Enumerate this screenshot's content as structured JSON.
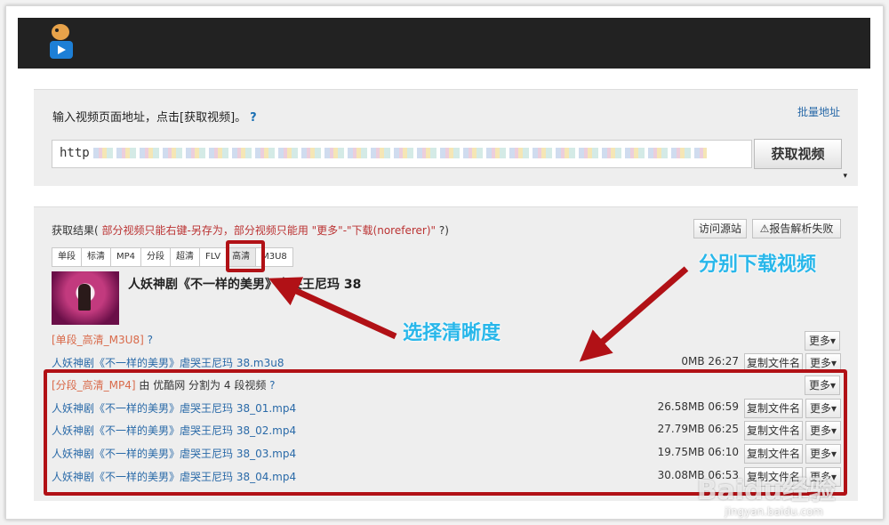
{
  "header": {
    "logo_icon": "video-logo-icon"
  },
  "input_card": {
    "prompt": "输入视频页面地址，点击[获取视频]。",
    "help": "?",
    "batch_link": "批量地址",
    "url_value": "http",
    "get_button": "获取视频",
    "expand_icon": "▾"
  },
  "results": {
    "label": "获取结果(",
    "note": "部分视频只能右键-另存为，部分视频只能用 \"更多\"-\"下载(noreferer)\"",
    "suffix": "?)",
    "visit_source": "访问源站",
    "report": "报告解析失败",
    "warning_icon": "⚠",
    "tabs": [
      "单段",
      "标清",
      "MP4",
      "分段",
      "超清",
      "FLV",
      "高清",
      "M3U8"
    ],
    "active_tab": "高清",
    "video_title": "人妖神剧《不一样的美男》虐哭王尼玛 38",
    "sections": [
      {
        "tag": "[单段_高清_M3U8]",
        "desc": "",
        "help": "?",
        "more": "更多▾",
        "files": [
          {
            "name": "人妖神剧《不一样的美男》虐哭王尼玛 38.m3u8",
            "meta": "0MB 26:27",
            "copy": "复制文件名",
            "more": "更多▾"
          }
        ]
      },
      {
        "tag": "[分段_高清_MP4]",
        "desc": "由 优酷网 分割为 4 段视频",
        "help": "?",
        "more": "更多▾",
        "files": [
          {
            "name": "人妖神剧《不一样的美男》虐哭王尼玛 38_01.mp4",
            "meta": "26.58MB 06:59",
            "copy": "复制文件名",
            "more": "更多▾"
          },
          {
            "name": "人妖神剧《不一样的美男》虐哭王尼玛 38_02.mp4",
            "meta": "27.79MB 06:25",
            "copy": "复制文件名",
            "more": "更多▾"
          },
          {
            "name": "人妖神剧《不一样的美男》虐哭王尼玛 38_03.mp4",
            "meta": "19.75MB 06:10",
            "copy": "复制文件名",
            "more": "更多▾"
          },
          {
            "name": "人妖神剧《不一样的美男》虐哭王尼玛 38_04.mp4",
            "meta": "30.08MB 06:53",
            "copy": "复制文件名",
            "more": "更多▾"
          }
        ]
      }
    ]
  },
  "annotations": {
    "select_quality": "选择清晰度",
    "download_each": "分别下载视频",
    "accent_color": "#b11116",
    "callout_color": "#29b7ea"
  },
  "watermark": {
    "brand": "Baidu经验",
    "url": "jingyan.baidu.com"
  }
}
